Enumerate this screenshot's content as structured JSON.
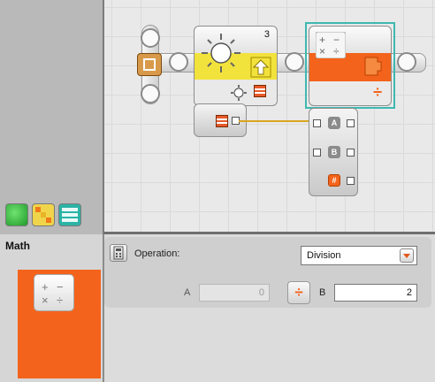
{
  "canvas": {
    "light_block": {
      "port_number": "3",
      "icon": "light-sensor-icon"
    },
    "math_block": {
      "icon": "math-operations-icon",
      "op_symbol": "÷"
    },
    "data_hub": {
      "plugs": [
        "A",
        "B",
        "#"
      ]
    }
  },
  "palette": {
    "tabs": [
      "common-palette-tab",
      "complete-palette-tab",
      "custom-palette-tab"
    ]
  },
  "config": {
    "title": "Math",
    "operation_label": "Operation:",
    "operation_value": "Division",
    "a_label": "A",
    "a_value": "0",
    "op_symbol": "÷",
    "b_label": "B",
    "b_value": "2"
  },
  "colors": {
    "accent_orange": "#f4631b",
    "light_yellow": "#f2e23c",
    "selection_cyan": "#3fb8b0",
    "wire_yellow": "#d9a520"
  }
}
